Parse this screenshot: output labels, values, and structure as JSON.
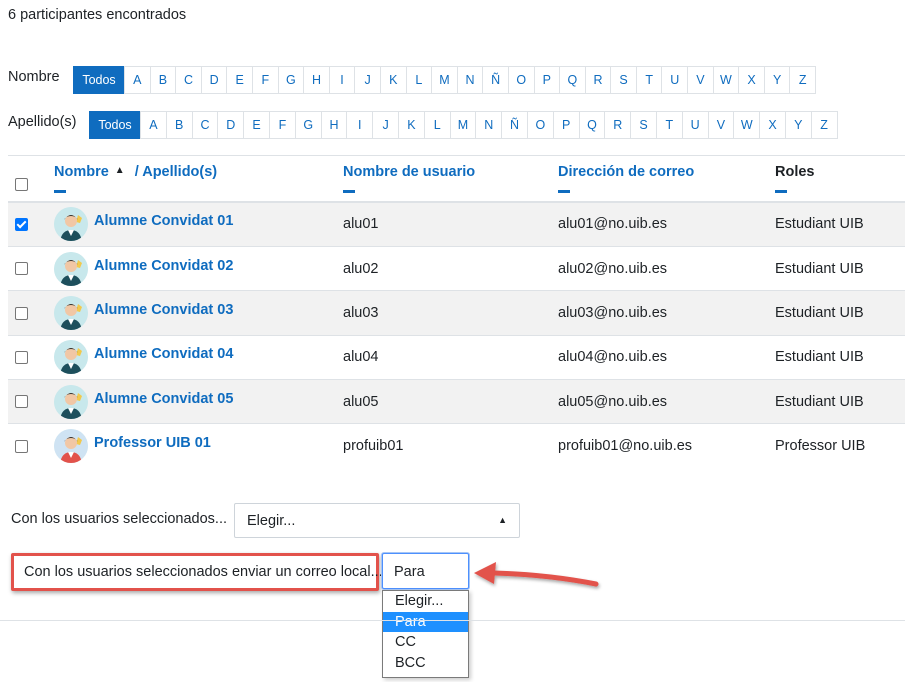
{
  "summary": "6 participantes encontrados",
  "firstname_bar": {
    "label": "Nombre",
    "letters": [
      "Todos",
      "A",
      "B",
      "C",
      "D",
      "E",
      "F",
      "G",
      "H",
      "I",
      "J",
      "K",
      "L",
      "M",
      "N",
      "Ñ",
      "O",
      "P",
      "Q",
      "R",
      "S",
      "T",
      "U",
      "V",
      "W",
      "X",
      "Y",
      "Z"
    ]
  },
  "lastname_bar": {
    "label": "Apellido(s)",
    "letters": [
      "Todos",
      "A",
      "B",
      "C",
      "D",
      "E",
      "F",
      "G",
      "H",
      "I",
      "J",
      "K",
      "L",
      "M",
      "N",
      "Ñ",
      "O",
      "P",
      "Q",
      "R",
      "S",
      "T",
      "U",
      "V",
      "W",
      "X",
      "Y",
      "Z"
    ]
  },
  "table": {
    "headers": {
      "name": "Nombre",
      "surname": "/ Apellido(s)",
      "username": "Nombre de usuario",
      "email": "Dirección de correo",
      "roles": "Roles"
    },
    "rows": [
      {
        "name": "Alumne Convidat 01",
        "username": "alu01",
        "email": "alu01@no.uib.es",
        "role": "Estudiant UIB",
        "checked": true
      },
      {
        "name": "Alumne Convidat 02",
        "username": "alu02",
        "email": "alu02@no.uib.es",
        "role": "Estudiant UIB",
        "checked": false
      },
      {
        "name": "Alumne Convidat 03",
        "username": "alu03",
        "email": "alu03@no.uib.es",
        "role": "Estudiant UIB",
        "checked": false
      },
      {
        "name": "Alumne Convidat 04",
        "username": "alu04",
        "email": "alu04@no.uib.es",
        "role": "Estudiant UIB",
        "checked": false
      },
      {
        "name": "Alumne Convidat 05",
        "username": "alu05",
        "email": "alu05@no.uib.es",
        "role": "Estudiant UIB",
        "checked": false
      },
      {
        "name": "Professor UIB 01",
        "username": "profuib01",
        "email": "profuib01@no.uib.es",
        "role": "Professor UIB",
        "checked": false
      }
    ]
  },
  "bulk_action": {
    "label": "Con los usuarios seleccionados...",
    "selected": "Elegir..."
  },
  "message_action": {
    "label": "Con los usuarios seleccionados enviar un correo local...",
    "selected": "Para",
    "options": [
      "Elegir...",
      "Para",
      "CC",
      "BCC"
    ]
  },
  "colors": {
    "accent": "#0f6cbf",
    "highlight": "#e2524b",
    "option_selected": "#1e90ff"
  }
}
